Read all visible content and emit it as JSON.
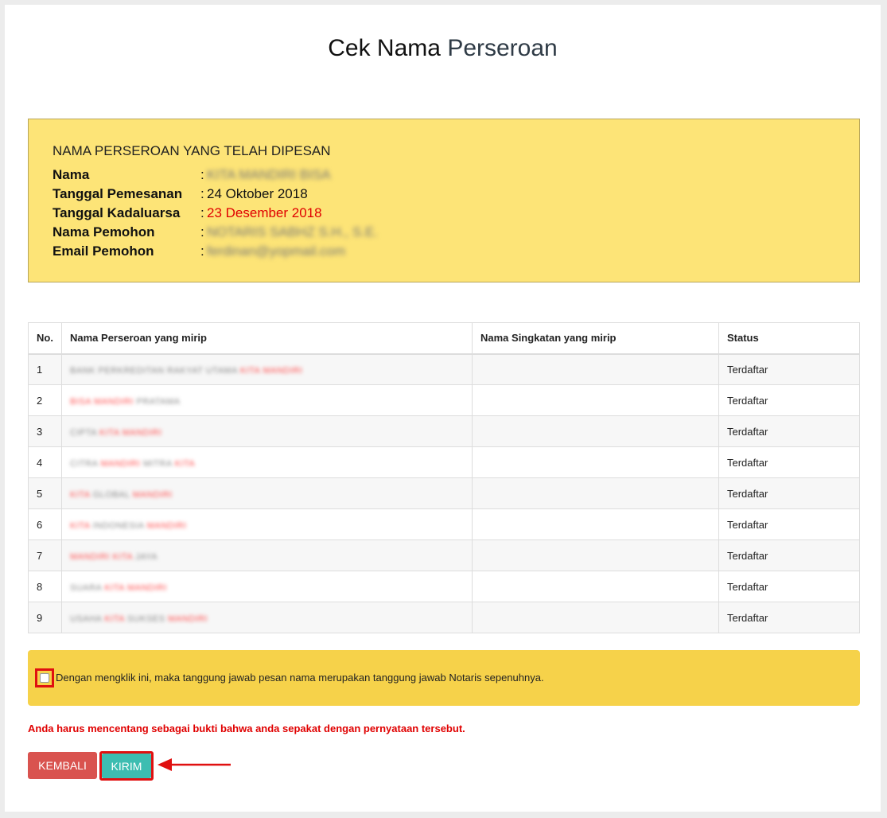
{
  "title": {
    "part1": "Cek Nama",
    "part2": "Perseroan"
  },
  "reserved": {
    "heading": "NAMA PERSEROAN YANG TELAH DIPESAN",
    "rows": [
      {
        "label": "Nama",
        "value": "KITA MANDIRI BISA",
        "blurred": true
      },
      {
        "label": "Tanggal Pemesanan",
        "value": "24 Oktober 2018",
        "blurred": false
      },
      {
        "label": "Tanggal Kadaluarsa",
        "value": "23 Desember 2018",
        "blurred": false,
        "highlight": "#e00000"
      },
      {
        "label": "Nama Pemohon",
        "value": "NOTARIS SABHZ S.H., S.E.",
        "blurred": true
      },
      {
        "label": "Email Pemohon",
        "value": "ferdinan@yopmail.com",
        "blurred": true
      }
    ]
  },
  "table": {
    "headers": [
      "No.",
      "Nama Perseroan yang mirip",
      "Nama Singkatan yang mirip",
      "Status"
    ],
    "rows": [
      {
        "no": "1",
        "name": [
          [
            "BANK PERKREDITAN RAKYAT UTAMA ",
            "g"
          ],
          [
            "KITA MANDIRI",
            "r"
          ]
        ],
        "abbr": "",
        "status": "Terdaftar"
      },
      {
        "no": "2",
        "name": [
          [
            "BISA MANDIRI",
            "r"
          ],
          [
            " PRATAMA",
            "g"
          ]
        ],
        "abbr": "",
        "status": "Terdaftar"
      },
      {
        "no": "3",
        "name": [
          [
            "CIPTA ",
            "g"
          ],
          [
            "KITA MANDIRI",
            "r"
          ]
        ],
        "abbr": "",
        "status": "Terdaftar"
      },
      {
        "no": "4",
        "name": [
          [
            "CITRA ",
            "g"
          ],
          [
            "MANDIRI",
            "r"
          ],
          [
            " MITRA ",
            "g"
          ],
          [
            "KITA",
            "r"
          ]
        ],
        "abbr": "",
        "status": "Terdaftar"
      },
      {
        "no": "5",
        "name": [
          [
            "KITA",
            "r"
          ],
          [
            " GLOBAL ",
            "g"
          ],
          [
            "MANDIRI",
            "r"
          ]
        ],
        "abbr": "",
        "status": "Terdaftar"
      },
      {
        "no": "6",
        "name": [
          [
            "KITA",
            "r"
          ],
          [
            " INDONESIA ",
            "g"
          ],
          [
            "MANDIRI",
            "r"
          ]
        ],
        "abbr": "",
        "status": "Terdaftar"
      },
      {
        "no": "7",
        "name": [
          [
            "MANDIRI KITA",
            "r"
          ],
          [
            " JAYA",
            "g"
          ]
        ],
        "abbr": "",
        "status": "Terdaftar"
      },
      {
        "no": "8",
        "name": [
          [
            "SUARA ",
            "g"
          ],
          [
            "KITA MANDIRI",
            "r"
          ]
        ],
        "abbr": "",
        "status": "Terdaftar"
      },
      {
        "no": "9",
        "name": [
          [
            "USAHA ",
            "g"
          ],
          [
            "KITA",
            "r"
          ],
          [
            " SUKSES ",
            "g"
          ],
          [
            "MANDIRI",
            "r"
          ]
        ],
        "abbr": "",
        "status": "Terdaftar"
      }
    ]
  },
  "agreement": {
    "text": "Dengan mengklik ini, maka tanggung jawab pesan nama merupakan tanggung jawab Notaris sepenuhnya.",
    "checked": false
  },
  "warning": "Anda harus mencentang sebagai bukti bahwa anda sepakat dengan pernyataan tersebut.",
  "buttons": {
    "back": "KEMBALI",
    "send": "KIRIM"
  },
  "colors": {
    "info_bg": "#fde477",
    "agree_bg": "#f6d24a",
    "danger": "#d9534f",
    "primary": "#3dbdb1",
    "highlight": "#e01010"
  },
  "icons": {
    "arrow": "left-arrow-annotation-icon"
  }
}
